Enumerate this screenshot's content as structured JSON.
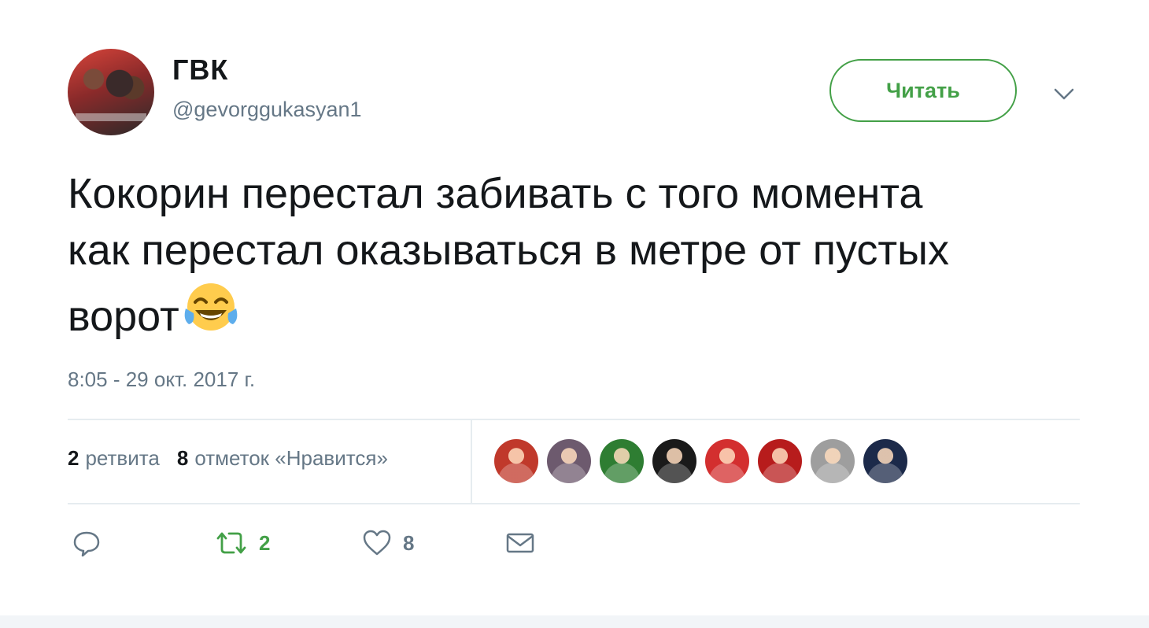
{
  "user": {
    "display_name": "ГВК",
    "handle": "@gevorggukasyan1"
  },
  "follow_button_label": "Читать",
  "tweet": {
    "text": "Кокорин перестал забивать с того момента\nкак перестал оказываться в метре от пустых\nворот",
    "emoji": "face-with-tears-of-joy",
    "timestamp": "8:05 - 29 окт. 2017 г."
  },
  "stats": {
    "retweets_count": "2",
    "retweets_label": "ретвита",
    "likes_count": "8",
    "likes_label": "отметок «Нравится»"
  },
  "likers": [
    {
      "name": "liker-avatar-1",
      "bg": "#c0392b"
    },
    {
      "name": "liker-avatar-2",
      "bg": "#6d5a6e"
    },
    {
      "name": "liker-avatar-3",
      "bg": "#2e7d32"
    },
    {
      "name": "liker-avatar-4",
      "bg": "#1a1a1a"
    },
    {
      "name": "liker-avatar-5",
      "bg": "#d32f2f"
    },
    {
      "name": "liker-avatar-6",
      "bg": "#b71c1c"
    },
    {
      "name": "liker-avatar-7",
      "bg": "#9e9e9e"
    },
    {
      "name": "liker-avatar-8",
      "bg": "#1c2a4a"
    }
  ],
  "actions": {
    "reply_count": "",
    "retweet_count": "2",
    "like_count": "8"
  },
  "colors": {
    "accent_green": "#43a047",
    "text_secondary": "#657786",
    "text_primary": "#14171a",
    "divider": "#e6ecf0"
  }
}
